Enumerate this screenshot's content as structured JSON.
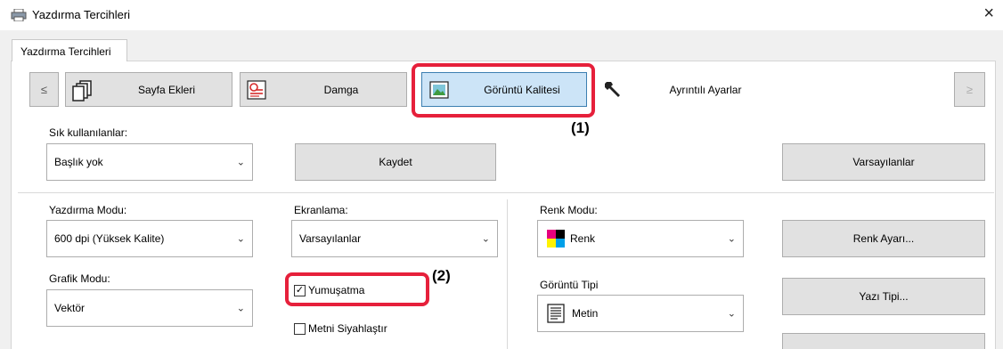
{
  "window": {
    "title": "Yazdırma Tercihleri",
    "close_glyph": "×"
  },
  "tab": {
    "label": "Yazdırma Tercihleri"
  },
  "ribbon": {
    "prev_arrow": "≤",
    "next_arrow": "≥",
    "items": [
      {
        "label": "Sayfa Ekleri",
        "icon": "page-stack-icon"
      },
      {
        "label": "Damga",
        "icon": "stamp-icon"
      },
      {
        "label": "Görüntü Kalitesi",
        "icon": "image-icon",
        "selected": true
      },
      {
        "label": "Ayrıntılı Ayarlar",
        "icon": "wrench-icon"
      }
    ]
  },
  "callouts": {
    "one": "(1)",
    "two": "(2)"
  },
  "favorites": {
    "label": "Sık kullanılanlar:",
    "value": "Başlık yok",
    "save_label": "Kaydet",
    "defaults_label": "Varsayılanlar"
  },
  "print_mode": {
    "label": "Yazdırma Modu:",
    "value": "600 dpi (Yüksek Kalite)"
  },
  "screening": {
    "label": "Ekranlama:",
    "value": "Varsayılanlar"
  },
  "color_mode": {
    "label": "Renk Modu:",
    "value": "Renk",
    "adjust_label": "Renk Ayarı..."
  },
  "graphics_mode": {
    "label": "Grafik Modu:",
    "value": "Vektör"
  },
  "smoothing": {
    "label": "Yumuşatma",
    "checked": true
  },
  "blacken_text": {
    "label": "Metni Siyahlaştır",
    "checked": false
  },
  "image_type": {
    "label": "Görüntü Tipi",
    "value": "Metin"
  },
  "font_button": {
    "label": "Yazı Tipi..."
  },
  "colors": {
    "accent_red": "#e6203b",
    "selected_blue": "#cce4f7"
  }
}
